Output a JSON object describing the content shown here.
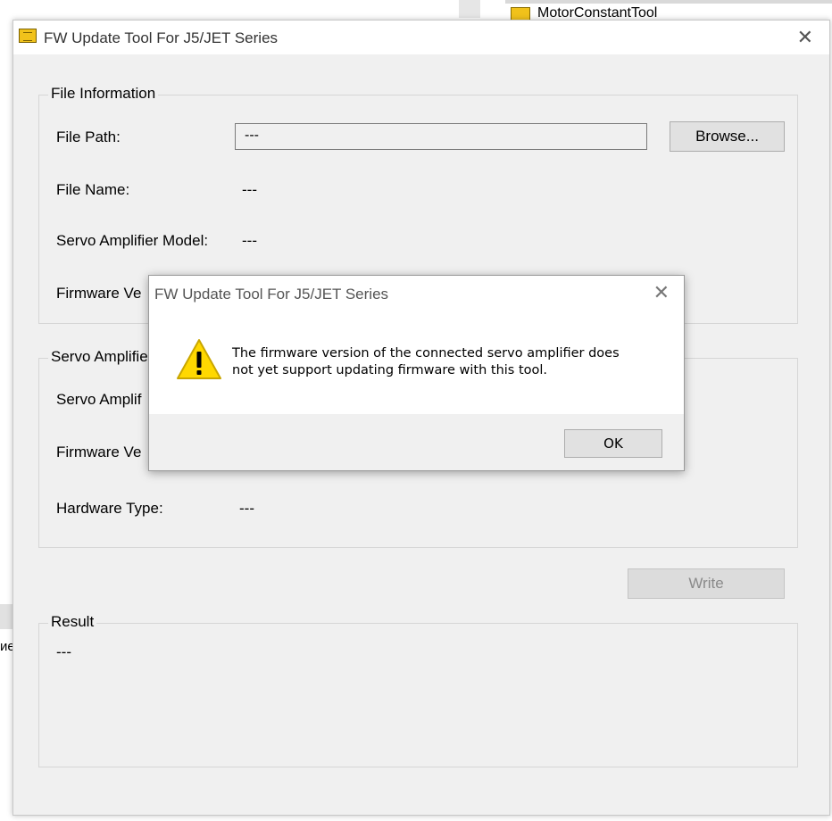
{
  "background": {
    "tool_label": "MotorConstantTool",
    "left_fragment": "ие"
  },
  "window": {
    "title": "FW Update Tool For J5/JET Series"
  },
  "file_info": {
    "group_title": "File Information",
    "path_label": "File Path:",
    "path_value": "---",
    "browse_label": "Browse...",
    "name_label": "File Name:",
    "name_value": "---",
    "model_label": "Servo Amplifier Model:",
    "model_value": "---",
    "fw_label": "Firmware Ve"
  },
  "servo_info": {
    "group_title": "Servo Amplifie",
    "model_label": "Servo Amplif",
    "fw_label": "Firmware Ve",
    "hw_label": "Hardware Type:",
    "hw_value": "---"
  },
  "write_label": "Write",
  "result": {
    "group_title": "Result",
    "value": "---"
  },
  "dialog": {
    "title": "FW Update Tool For J5/JET Series",
    "message_line1": "The firmware version of the connected servo amplifier does",
    "message_line2": "not yet support updating firmware with this tool.",
    "ok_label": "OK"
  },
  "colors": {
    "warning_fill": "#ffd800",
    "window_bg": "#f0f0f0"
  }
}
